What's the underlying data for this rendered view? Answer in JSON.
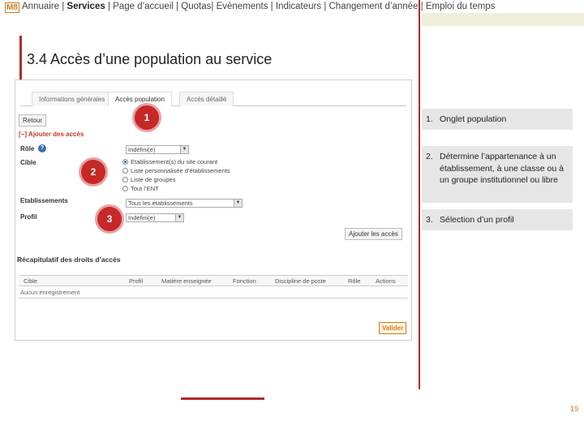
{
  "nav": {
    "logo": "M8",
    "items": [
      {
        "label": "Annuaire | "
      },
      {
        "label": "Services",
        "active": true
      },
      {
        "label": " | Page d’accueil | Quotas| Evènements | Indicateurs |   Changement d’année  | Emploi du temps"
      }
    ]
  },
  "slide": {
    "title": "3.4 Accès d’une population au service",
    "page_number": "19"
  },
  "screenshot": {
    "tabs": [
      "Informations générales",
      "Accès population",
      "Accès détaillé"
    ],
    "back_button": "Retour",
    "add_section": "[−] Ajouter des accès",
    "role_label": "Rôle",
    "role_select": "Indéfini(e)",
    "target_label": "Cible",
    "target_options": [
      "Etablissement(s) du site courant",
      "Liste personnalisée d’établissements",
      "Liste de groupes",
      "Tout l’ENT"
    ],
    "establishments_label": "Etablissements",
    "establishments_select": "Tous les établissements",
    "profile_label": "Profil",
    "profile_select": "Indéfini(e)",
    "add_access_button": "Ajouter les accès",
    "summary_title": "Récapitulatif des droits d’accès",
    "grid_headers": [
      "Cible",
      "Profil",
      "Matière enseignée",
      "Fonction",
      "Discipline de poste",
      "Rôle",
      "Actions"
    ],
    "grid_empty": "Aucun enregistrement",
    "validate_button": "Valider"
  },
  "markers": [
    "1",
    "2",
    "3"
  ],
  "callouts": [
    {
      "num": "1.",
      "text": "Onglet population"
    },
    {
      "num": "2.",
      "text": "Détermine l’appartenance à un établissement, à une classe ou à un groupe institutionnel ou libre"
    },
    {
      "num": "3.",
      "text": "Sélection d’un profil"
    }
  ],
  "colors": {
    "accent": "#b22a2a",
    "marker": "#c62828",
    "callout_bg": "#e6e6e6",
    "logo": "#c97f1c"
  }
}
